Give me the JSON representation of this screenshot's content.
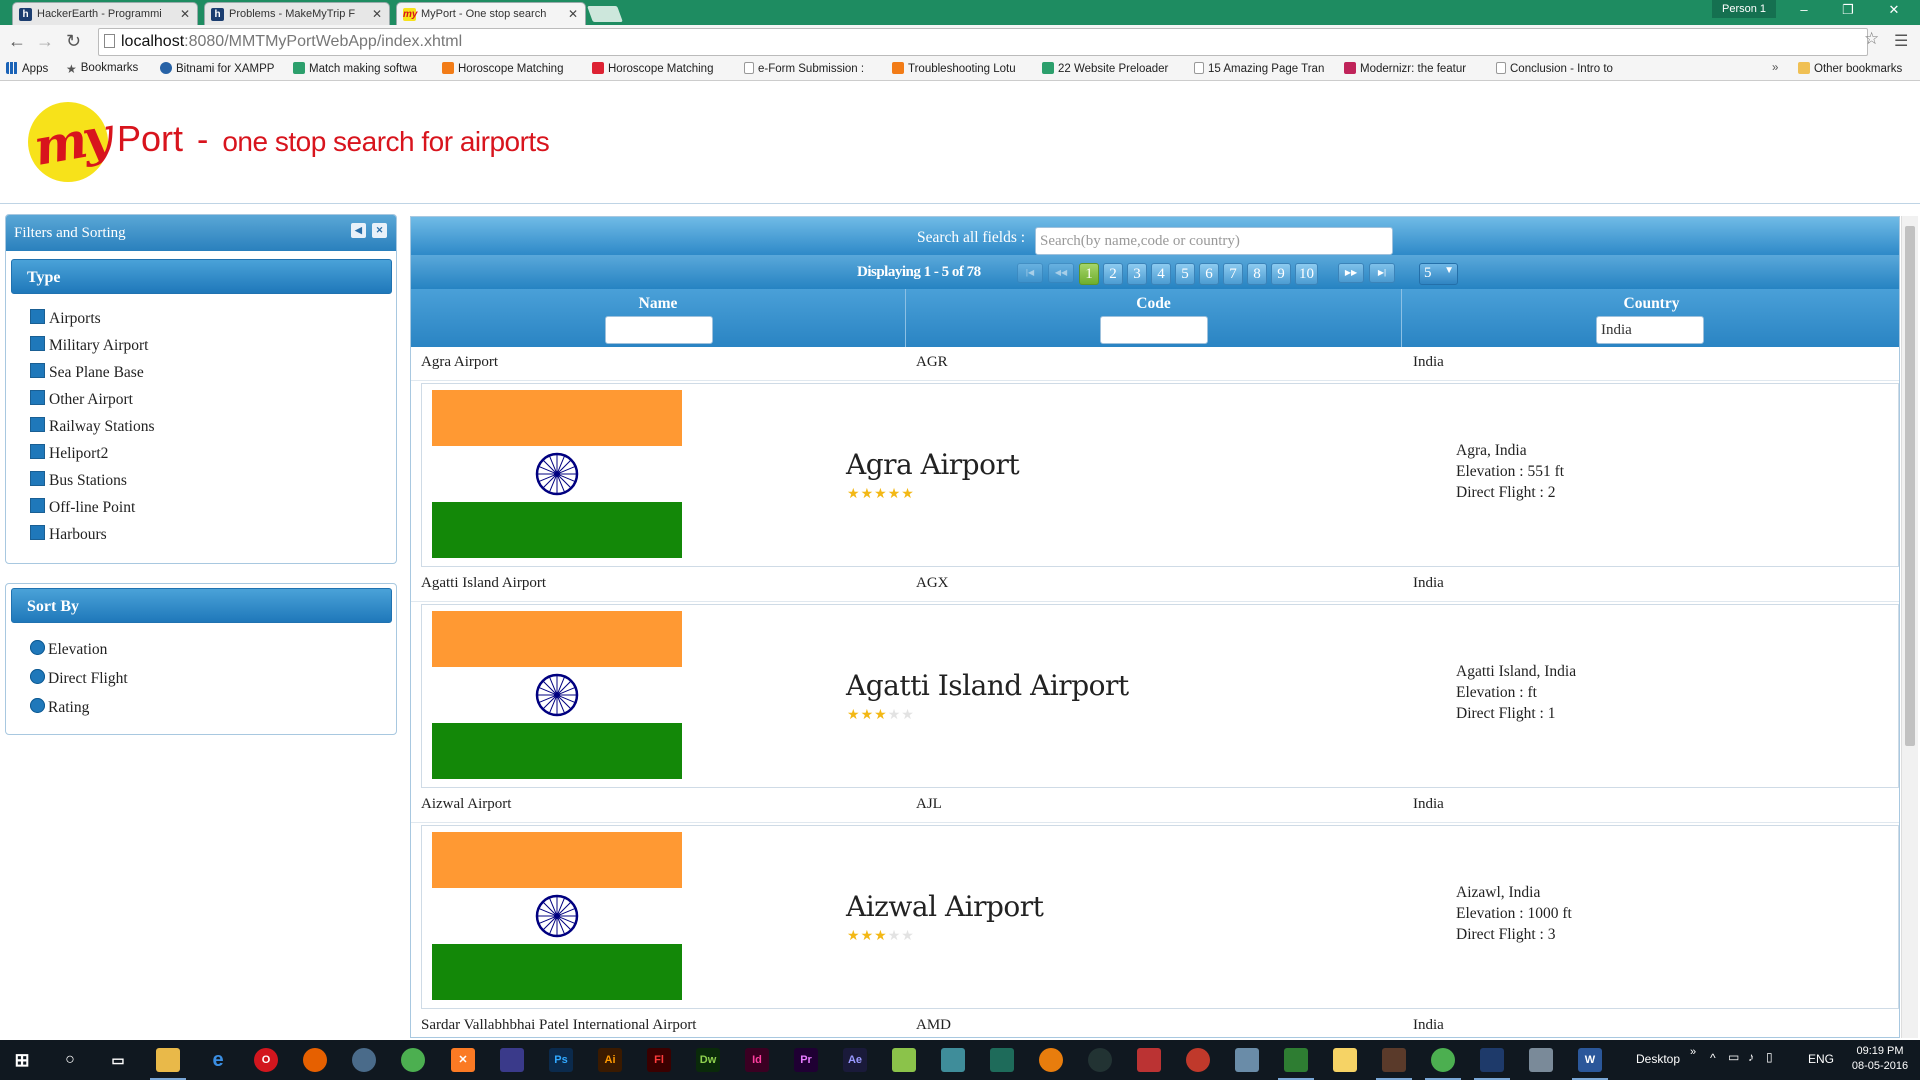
{
  "browser": {
    "tabs": [
      {
        "title": "HackerEarth - Programmi",
        "icon": "h"
      },
      {
        "title": "Problems - MakeMyTrip F",
        "icon": "h"
      },
      {
        "title": "MyPort - One stop search",
        "icon": "my"
      }
    ],
    "person": "Person 1",
    "url_host": "localhost",
    "url_path": ":8080/MMTMyPortWebApp/index.xhtml",
    "bookmarks": [
      {
        "label": "Apps",
        "icon": "grid"
      },
      {
        "label": "Bookmarks",
        "icon": "star"
      },
      {
        "label": "Bitnami for XAMPP",
        "icon": "blue"
      },
      {
        "label": "Match making softwa",
        "icon": "green"
      },
      {
        "label": "Horoscope Matching",
        "icon": "orange"
      },
      {
        "label": "Horoscope Matching",
        "icon": "red"
      },
      {
        "label": "e-Form Submission :",
        "icon": "page"
      },
      {
        "label": "Troubleshooting Lotu",
        "icon": "orange"
      },
      {
        "label": "22 Website Preloader",
        "icon": "green"
      },
      {
        "label": "15 Amazing Page Tran",
        "icon": "page"
      },
      {
        "label": "Modernizr: the featur",
        "icon": "pink"
      },
      {
        "label": "Conclusion - Intro to",
        "icon": "page"
      }
    ],
    "other_bookmarks": "Other bookmarks"
  },
  "header": {
    "logo_text": "my",
    "brand": "Port",
    "separator": "-",
    "tagline": "one stop search for airports"
  },
  "filters": {
    "title": "Filters and Sorting",
    "type_heading": "Type",
    "type_options": [
      "Airports",
      "Military Airport",
      "Sea Plane Base",
      "Other Airport",
      "Railway Stations",
      "Heliport2",
      "Bus Stations",
      "Off-line Point",
      "Harbours"
    ],
    "sort_heading": "Sort By",
    "sort_options": [
      "Elevation",
      "Direct Flight",
      "Rating"
    ]
  },
  "grid": {
    "search_label": "Search all fields :",
    "search_placeholder": "Search(by name,code or country)",
    "displaying": "Displaying 1 - 5 of 78",
    "pages": [
      "1",
      "2",
      "3",
      "4",
      "5",
      "6",
      "7",
      "8",
      "9",
      "10"
    ],
    "current_page": "1",
    "nav": {
      "first": "|◀",
      "prev": "◀◀",
      "next": "▶▶",
      "last": "▶|"
    },
    "rows_per_page": "5",
    "columns": [
      {
        "label": "Name",
        "filter": ""
      },
      {
        "label": "Code",
        "filter": ""
      },
      {
        "label": "Country",
        "filter": "India"
      }
    ],
    "rows": [
      {
        "name": "Agra Airport",
        "code": "AGR",
        "country": "India",
        "location": "Agra, India",
        "elevation": "Elevation : 551 ft",
        "direct": "Direct Flight : 2",
        "rating": 5
      },
      {
        "name": "Agatti Island Airport",
        "code": "AGX",
        "country": "India",
        "location": "Agatti Island, India",
        "elevation": "Elevation : ft",
        "direct": "Direct Flight : 1",
        "rating": 3
      },
      {
        "name": "Aizwal Airport",
        "code": "AJL",
        "country": "India",
        "location": "Aizawl, India",
        "elevation": "Elevation : 1000 ft",
        "direct": "Direct Flight : 3",
        "rating": 3
      },
      {
        "name": "Sardar Vallabhbhai Patel International Airport",
        "code": "AMD",
        "country": "India"
      }
    ],
    "max_rating": 5
  },
  "taskbar": {
    "desktop_label": "Desktop",
    "lang": "ENG",
    "time": "09:19 PM",
    "date": "08-05-2016"
  },
  "colors": {
    "brand_red": "#d8141d",
    "logo_yellow": "#f7e21a",
    "header_blue": "#2a80bd",
    "saffron": "#ff9933",
    "india_green": "#138808",
    "chakra_blue": "#000080",
    "star_gold": "#f3b815"
  }
}
